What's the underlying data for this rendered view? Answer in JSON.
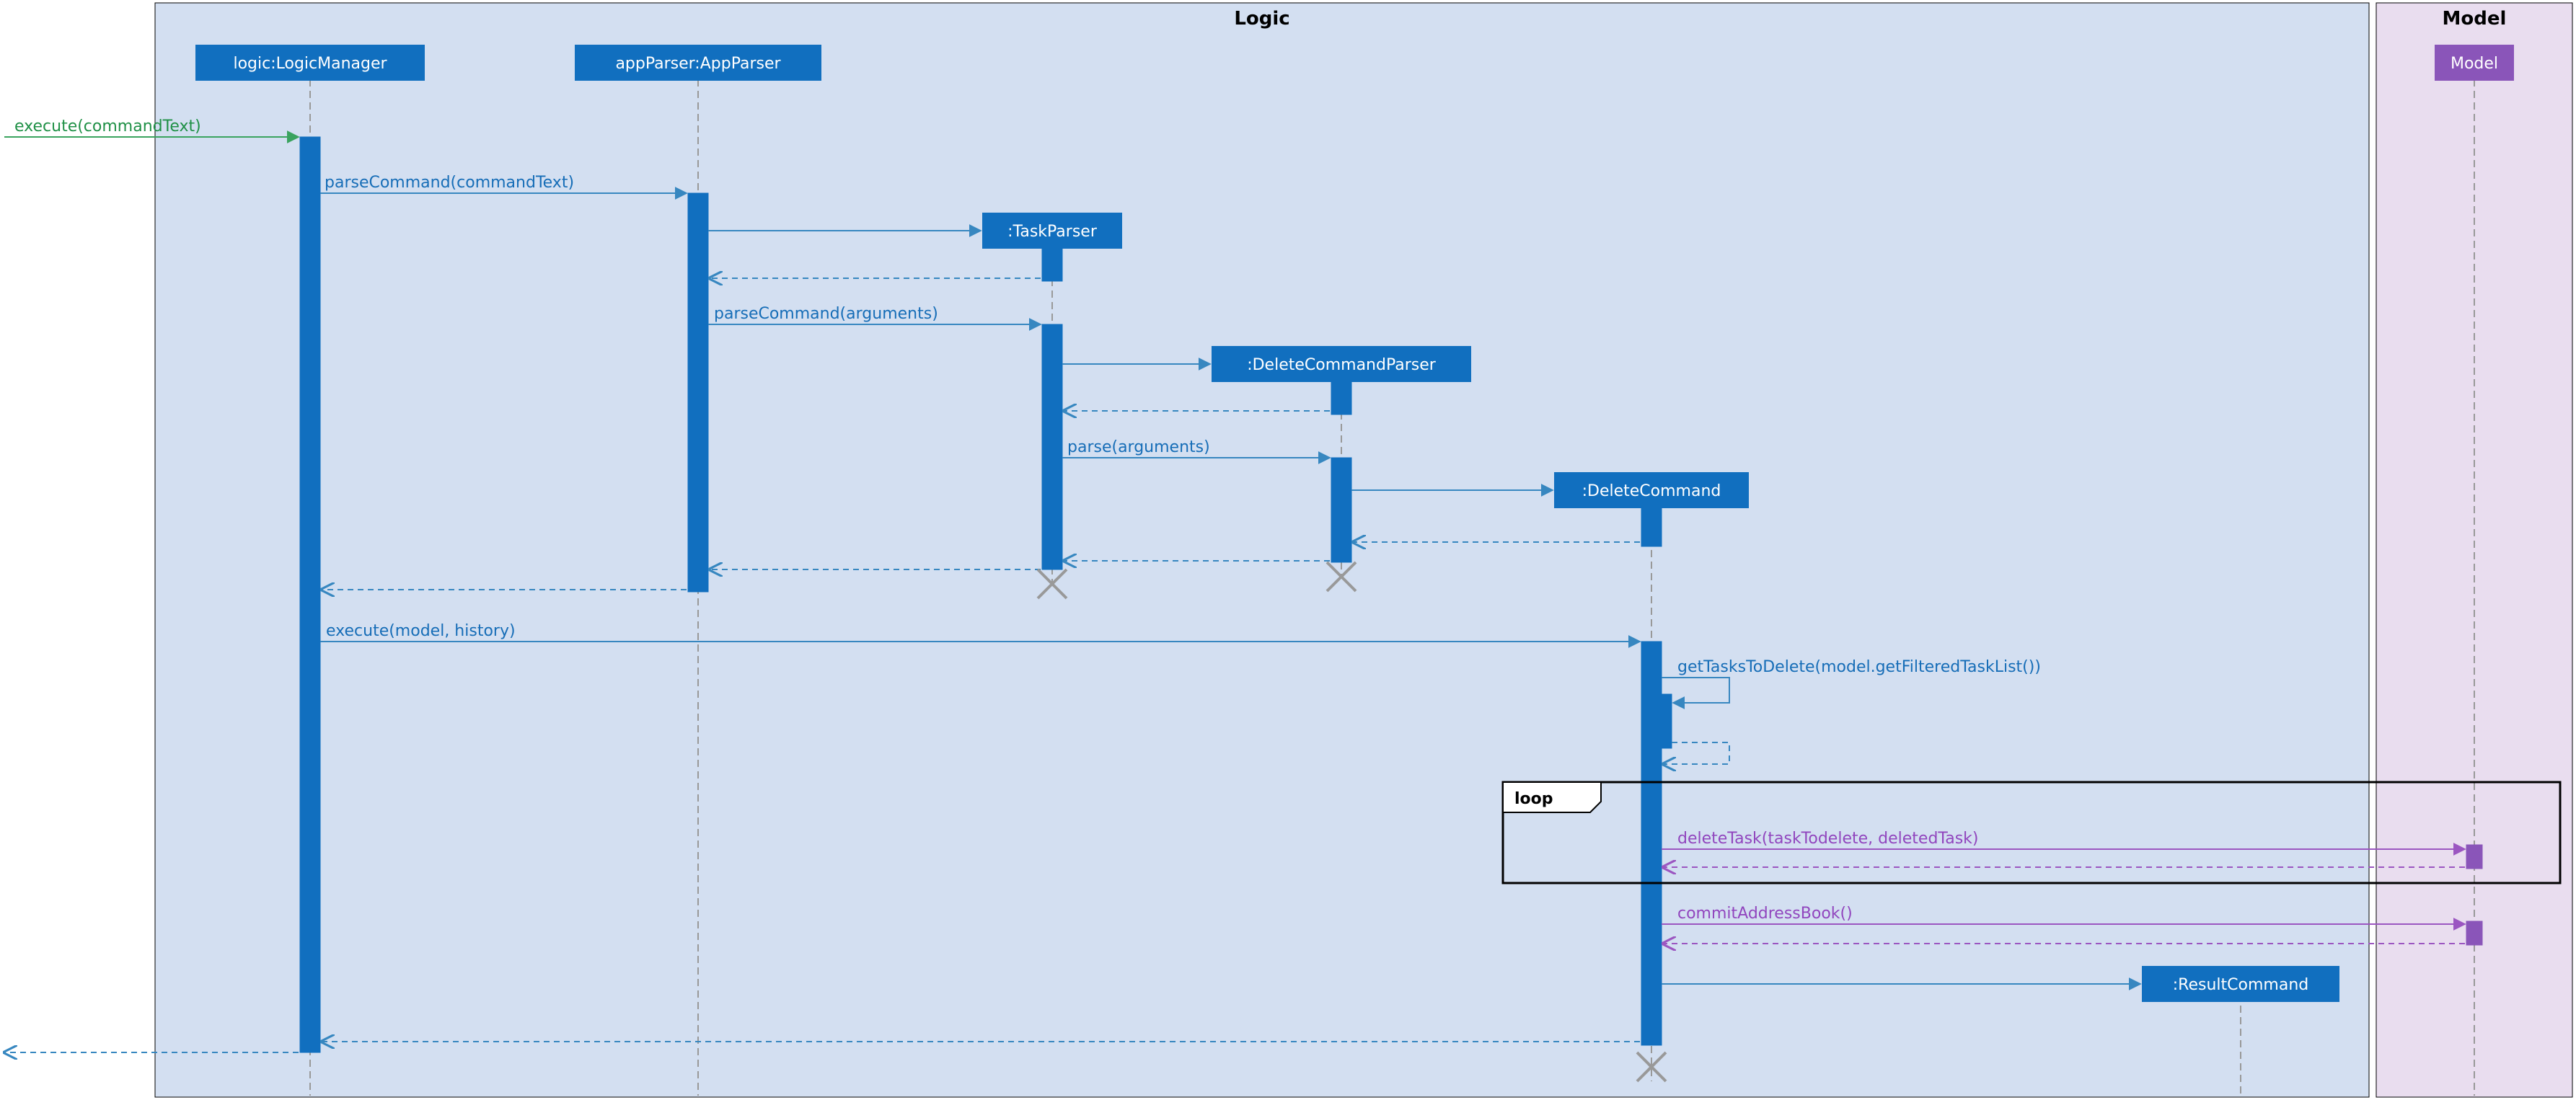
{
  "regions": {
    "logic_title": "Logic",
    "model_title": "Model"
  },
  "participants": {
    "logic_manager": "logic:LogicManager",
    "app_parser": "appParser:AppParser",
    "task_parser": ":TaskParser",
    "delete_cmd_parser": ":DeleteCommandParser",
    "delete_command": ":DeleteCommand",
    "result_command": ":ResultCommand",
    "model": "Model"
  },
  "messages": {
    "execute_cmd_text": "execute(commandText)",
    "parse_command_text": "parseCommand(commandText)",
    "parse_command_args": "parseCommand(arguments)",
    "parse_args": "parse(arguments)",
    "execute_model_hist": "execute(model, history)",
    "get_tasks_to_delete": "getTasksToDelete(model.getFilteredTaskList())",
    "delete_task": "deleteTask(taskTodelete, deletedTask)",
    "commit_addr_book": "commitAddressBook()"
  },
  "frames": {
    "loop_label": "loop"
  }
}
